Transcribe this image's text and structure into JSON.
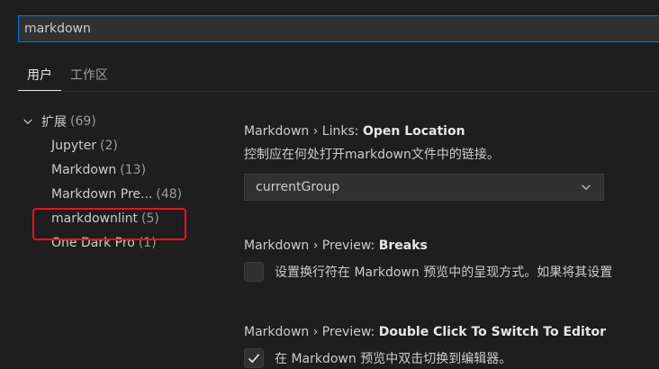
{
  "search": {
    "value": "markdown"
  },
  "tabs": [
    {
      "label": "用户",
      "active": true
    },
    {
      "label": "工作区",
      "active": false
    }
  ],
  "tree": {
    "root_label": "扩展",
    "root_count": "(69)",
    "items": [
      {
        "label": "Jupyter",
        "count": "(2)"
      },
      {
        "label": "Markdown",
        "count": "(13)"
      },
      {
        "label": "Markdown Pre...",
        "count": "(48)"
      },
      {
        "label": "markdownlint",
        "count": "(5)"
      },
      {
        "label": "One Dark Pro",
        "count": "(1)"
      }
    ]
  },
  "settings": {
    "links": {
      "prefix": "Markdown › Links: ",
      "name": "Open Location",
      "description": "控制应在何处打开markdown文件中的链接。",
      "value": "currentGroup"
    },
    "breaks": {
      "prefix": "Markdown › Preview: ",
      "name": "Breaks",
      "description": "设置换行符在 Markdown 预览中的呈现方式。如果将其设置",
      "checked": false
    },
    "dblclick": {
      "prefix": "Markdown › Preview: ",
      "name": "Double Click To Switch To Editor",
      "description": "在 Markdown 预览中双击切换到编辑器。",
      "checked": true
    }
  },
  "colors": {
    "background": "#1e1e1e",
    "focus_border": "#0078d4",
    "highlight": "#e81123"
  }
}
